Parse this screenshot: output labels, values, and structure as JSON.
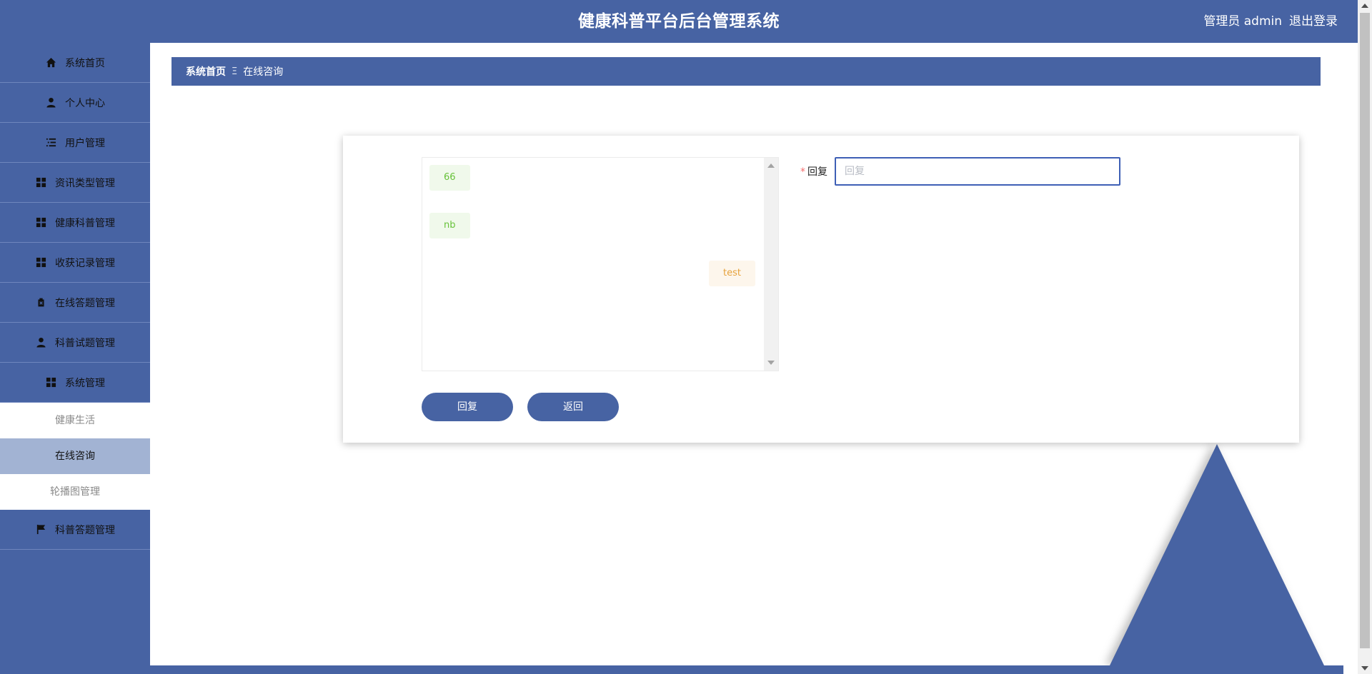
{
  "header": {
    "title": "健康科普平台后台管理系统",
    "user_label": "管理员 admin",
    "logout_label": "退出登录"
  },
  "sidebar": {
    "items": [
      {
        "label": "系统首页",
        "icon": "home-icon"
      },
      {
        "label": "个人中心",
        "icon": "user-icon"
      },
      {
        "label": "用户管理",
        "icon": "list-icon"
      },
      {
        "label": "资讯类型管理",
        "icon": "grid-icon"
      },
      {
        "label": "健康科普管理",
        "icon": "grid-icon"
      },
      {
        "label": "收获记录管理",
        "icon": "grid-icon"
      },
      {
        "label": "在线答题管理",
        "icon": "clipboard-icon"
      },
      {
        "label": "科普试题管理",
        "icon": "user-icon"
      },
      {
        "label": "系统管理",
        "icon": "grid-icon"
      }
    ],
    "submenu": [
      {
        "label": "健康生活",
        "active": false
      },
      {
        "label": "在线咨询",
        "active": true
      },
      {
        "label": "轮播图管理",
        "active": false
      }
    ],
    "last_item": {
      "label": "科普答题管理",
      "icon": "flag-icon"
    }
  },
  "breadcrumb": {
    "home": "系统首页",
    "separator": "Ξ",
    "current": "在线咨询"
  },
  "chat": {
    "messages": [
      {
        "text": "66",
        "side": "left"
      },
      {
        "text": "nb",
        "side": "left"
      },
      {
        "text": "test",
        "side": "right"
      }
    ]
  },
  "form": {
    "reply_label": "回复",
    "required_mark": "*",
    "reply_placeholder": "回复",
    "reply_value": ""
  },
  "buttons": {
    "reply": "回复",
    "back": "返回"
  },
  "colors": {
    "primary": "#4763a3",
    "active_sub": "#a2b3d3",
    "chat_left_bg": "#f0f9eb",
    "chat_left_text": "#67c23a",
    "chat_right_bg": "#fdf6ec",
    "chat_right_text": "#e6a23c"
  }
}
